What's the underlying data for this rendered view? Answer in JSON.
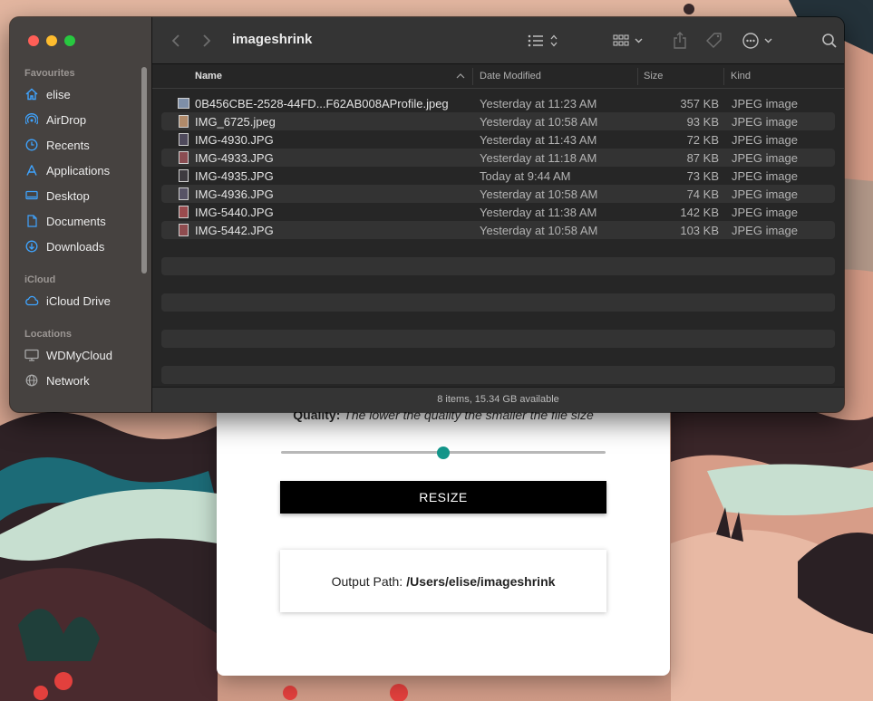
{
  "finder": {
    "title": "imageshrink",
    "sidebar": {
      "favourites_heading": "Favourites",
      "favourites": [
        {
          "label": "elise",
          "icon": "house-icon"
        },
        {
          "label": "AirDrop",
          "icon": "airdrop-icon"
        },
        {
          "label": "Recents",
          "icon": "clock-icon"
        },
        {
          "label": "Applications",
          "icon": "applications-icon"
        },
        {
          "label": "Desktop",
          "icon": "desktop-icon"
        },
        {
          "label": "Documents",
          "icon": "document-icon"
        },
        {
          "label": "Downloads",
          "icon": "download-icon"
        }
      ],
      "icloud_heading": "iCloud",
      "icloud": [
        {
          "label": "iCloud Drive",
          "icon": "cloud-icon"
        }
      ],
      "locations_heading": "Locations",
      "locations": [
        {
          "label": "WDMyCloud",
          "icon": "display-icon"
        },
        {
          "label": "Network",
          "icon": "globe-icon"
        }
      ]
    },
    "columns": {
      "name": "Name",
      "date": "Date Modified",
      "size": "Size",
      "kind": "Kind"
    },
    "files": [
      {
        "name": "0B456CBE-2528-44FD...F62AB008AProfile.jpeg",
        "date": "Yesterday at 11:23 AM",
        "size": "357 KB",
        "kind": "JPEG image"
      },
      {
        "name": "IMG_6725.jpeg",
        "date": "Yesterday at 10:58 AM",
        "size": "93 KB",
        "kind": "JPEG image"
      },
      {
        "name": "IMG-4930.JPG",
        "date": "Yesterday at 11:43 AM",
        "size": "72 KB",
        "kind": "JPEG image"
      },
      {
        "name": "IMG-4933.JPG",
        "date": "Yesterday at 11:18 AM",
        "size": "87 KB",
        "kind": "JPEG image"
      },
      {
        "name": "IMG-4935.JPG",
        "date": "Today at 9:44 AM",
        "size": "73 KB",
        "kind": "JPEG image"
      },
      {
        "name": "IMG-4936.JPG",
        "date": "Yesterday at 10:58 AM",
        "size": "74 KB",
        "kind": "JPEG image"
      },
      {
        "name": "IMG-5440.JPG",
        "date": "Yesterday at 11:38 AM",
        "size": "142 KB",
        "kind": "JPEG image"
      },
      {
        "name": "IMG-5442.JPG",
        "date": "Yesterday at 10:58 AM",
        "size": "103 KB",
        "kind": "JPEG image"
      }
    ],
    "status": "8 items, 15.34 GB available"
  },
  "app": {
    "quality_label": "Quality:",
    "quality_hint": "The lower the quality the smaller the file size",
    "quality_value": 0.5,
    "resize_label": "RESIZE",
    "output_label": "Output Path:",
    "output_path": "/Users/elise/imageshrink",
    "accent_color": "#13968a"
  }
}
